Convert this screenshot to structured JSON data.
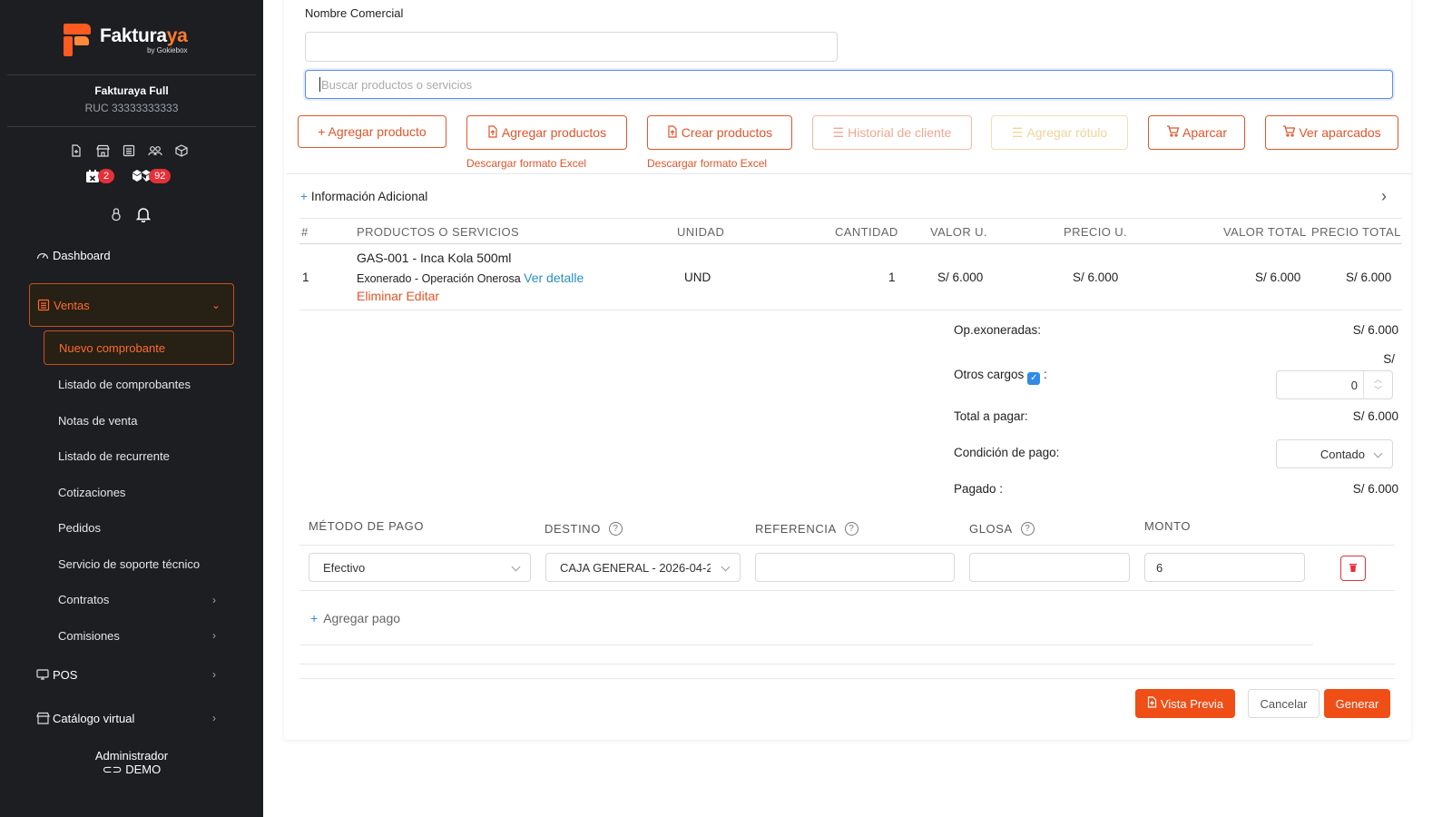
{
  "brand": {
    "name_main": "Fakturaya",
    "name_accent": "ya",
    "name_prefix": "Faktura",
    "by": "by Gokiebox"
  },
  "company": {
    "name": "Fakturaya Full",
    "ruc": "RUC 33333333333"
  },
  "badges": {
    "calendar_count": "2",
    "boxes_count": "92"
  },
  "nav": {
    "dashboard": "Dashboard",
    "ventas": "Ventas",
    "ventas_sub": [
      "Nuevo comprobante",
      "Listado de comprobantes",
      "Notas de venta",
      "Listado de recurrente",
      "Cotizaciones",
      "Pedidos",
      "Servicio de soporte técnico",
      "Contratos",
      "Comisiones"
    ],
    "pos": "POS",
    "catalogo": "Catálogo virtual"
  },
  "user": {
    "role": "Administrador",
    "name": "DEMO"
  },
  "form": {
    "nombre_comercial_label": "Nombre Comercial",
    "nombre_comercial_value": "",
    "search_placeholder": "Buscar productos o servicios"
  },
  "actions": {
    "agregar_producto": "+ Agregar producto",
    "agregar_productos": "Agregar productos",
    "crear_productos": "Crear productos",
    "historial_cliente": "Historial de cliente",
    "agregar_rotulo": "Agregar rótulo",
    "aparcar": "Aparcar",
    "ver_aparcados": "Ver aparcados",
    "descargar_formato_1": "Descargar formato Excel",
    "descargar_formato_2": "Descargar formato Excel"
  },
  "info_adicional": "Información Adicional",
  "table": {
    "headers": {
      "num": "#",
      "productos": "PRODUCTOS O SERVICIOS",
      "unidad": "UNIDAD",
      "cantidad": "CANTIDAD",
      "valor_u": "VALOR U.",
      "precio_u": "PRECIO U.",
      "valor_total": "VALOR TOTAL",
      "precio_total": "PRECIO TOTAL"
    },
    "rows": [
      {
        "num": "1",
        "name": "GAS-001 - Inca Kola 500ml",
        "detail": "Exonerado - Operación Onerosa",
        "ver_detalle": "Ver detalle",
        "eliminar": "Eliminar",
        "editar": "Editar",
        "unidad": "UND",
        "cantidad": "1",
        "valor_u": "S/ 6.000",
        "precio_u": "S/ 6.000",
        "valor_total": "S/ 6.000",
        "precio_total": "S/ 6.000"
      }
    ]
  },
  "summary": {
    "op_exoneradas_label": "Op.exoneradas:",
    "op_exoneradas_value": "S/ 6.000",
    "otros_cargos_label": "Otros cargos",
    "otros_cargos_colon": ":",
    "otros_cargos_currency": "S/",
    "otros_cargos_value": "0",
    "total_label": "Total a pagar:",
    "total_value": "S/ 6.000",
    "condicion_label": "Condición de pago:",
    "condicion_value": "Contado",
    "pagado_label": "Pagado :",
    "pagado_value": "S/ 6.000"
  },
  "payments": {
    "headers": {
      "metodo": "MÉTODO DE PAGO",
      "destino": "DESTINO",
      "referencia": "REFERENCIA",
      "glosa": "GLOSA",
      "monto": "MONTO"
    },
    "row": {
      "metodo": "Efectivo",
      "destino": "CAJA GENERAL - 2026-04-2",
      "referencia": "",
      "glosa": "",
      "monto": "6"
    },
    "agregar_pago": "Agregar pago"
  },
  "footer": {
    "vista_previa": "Vista Previa",
    "cancelar": "Cancelar",
    "generar": "Generar"
  },
  "colors": {
    "accent": "#e2552a",
    "sidebar_bg": "#1c1e22",
    "link": "#2a8fbd",
    "primary_btn": "#f04e17"
  }
}
